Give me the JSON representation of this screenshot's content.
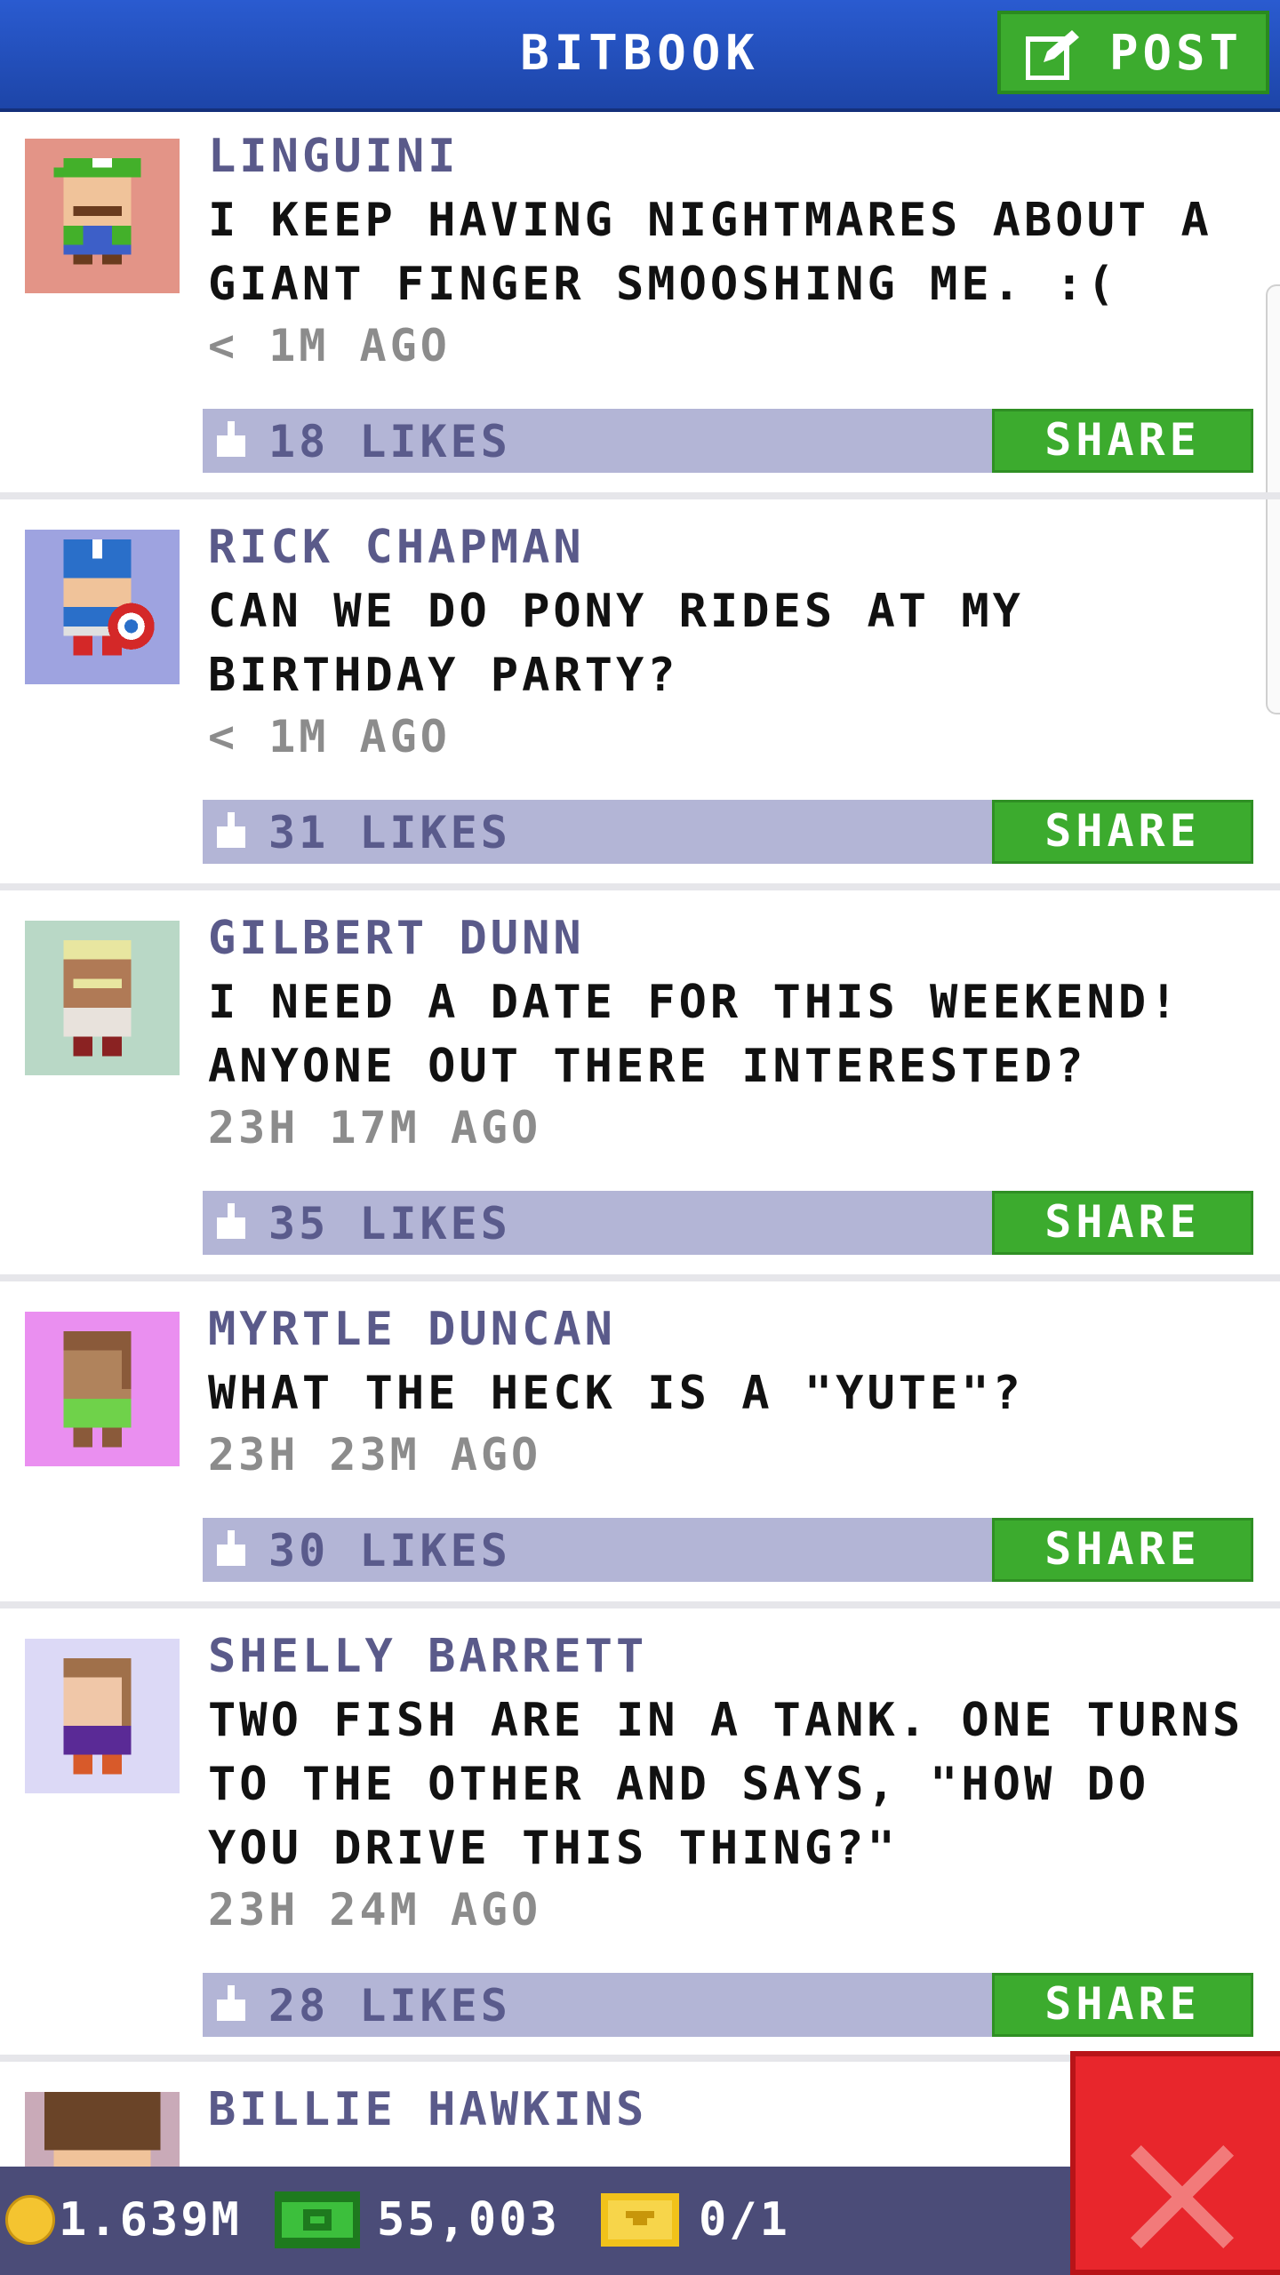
{
  "header": {
    "title": "BITBOOK",
    "post_label": "POST"
  },
  "posts": [
    {
      "name": "LINGUINI",
      "message": "I KEEP HAVING NIGHTMARES ABOUT A GIANT FINGER SMOOSHING ME. :(",
      "time": "< 1M AGO",
      "likes": "18 LIKES",
      "share_label": "SHARE",
      "avatar_bg": "#e39487"
    },
    {
      "name": "RICK CHAPMAN",
      "message": "CAN WE DO PONY RIDES AT MY BIRTHDAY PARTY?",
      "time": "< 1M AGO",
      "likes": "31 LIKES",
      "share_label": "SHARE",
      "avatar_bg": "#9ea3e0"
    },
    {
      "name": "GILBERT DUNN",
      "message": "I NEED A DATE FOR THIS WEEKEND! ANYONE OUT THERE INTERESTED?",
      "time": "23H 17M AGO",
      "likes": "35 LIKES",
      "share_label": "SHARE",
      "avatar_bg": "#b9d8c6"
    },
    {
      "name": "MYRTLE DUNCAN",
      "message": "WHAT THE HECK IS A \"YUTE\"?",
      "time": "23H 23M AGO",
      "likes": "30 LIKES",
      "share_label": "SHARE",
      "avatar_bg": "#ea8ff0"
    },
    {
      "name": "SHELLY BARRETT",
      "message": "TWO FISH ARE IN A TANK. ONE TURNS TO THE OTHER AND SAYS, \"HOW DO YOU DRIVE THIS THING?\"",
      "time": "23H 24M AGO",
      "likes": "28 LIKES",
      "share_label": "SHARE",
      "avatar_bg": "#dcd9f6"
    },
    {
      "name": "BILLIE HAWKINS",
      "avatar_bg": "#c9aab8"
    }
  ],
  "status": {
    "coins": "1.639M",
    "bux": "55,003",
    "tickets": "0/1"
  },
  "colors": {
    "header_blue": "#2a5bd0",
    "share_green": "#3cab2e",
    "like_bar": "#b3b5d6",
    "name_purple": "#5a5a8a",
    "close_red": "#e8262c",
    "bottom_bar": "#4b4c78"
  },
  "icons": {
    "post": "edit-icon",
    "like": "thumbs-up-icon",
    "coin": "coin-icon",
    "bux": "cash-icon",
    "ticket": "ticket-icon",
    "close": "close-icon"
  }
}
